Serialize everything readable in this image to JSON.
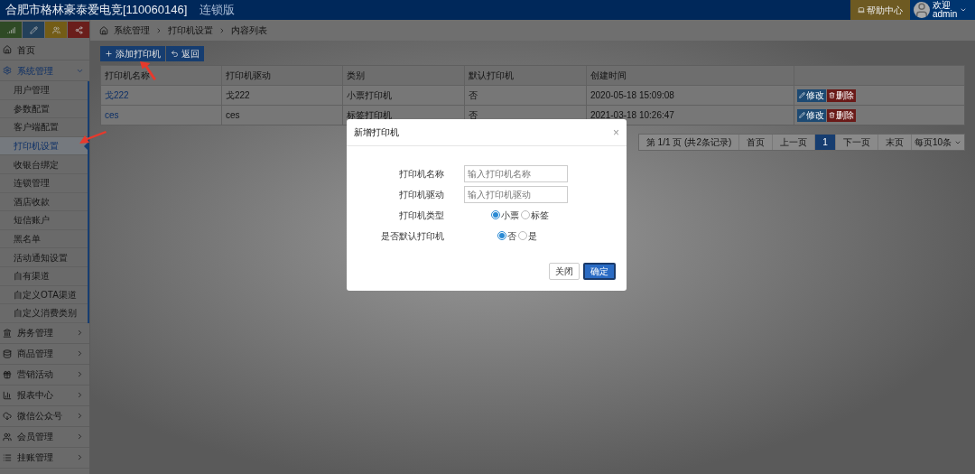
{
  "header": {
    "title": "合肥市格林豪泰爱电竞[110060146]",
    "edition": "连锁版",
    "help": "帮助中心",
    "welcome": "欢迎",
    "user": "admin"
  },
  "sidebar": {
    "shortcuts": [
      {
        "kind": "chart",
        "color": "#2f4a25"
      },
      {
        "kind": "pencil",
        "color": "#23405a"
      },
      {
        "kind": "users",
        "color": "#735c16"
      },
      {
        "kind": "share",
        "color": "#6a1e1b"
      }
    ],
    "items": [
      {
        "label": "首页",
        "expanded": false
      },
      {
        "label": "系统管理",
        "expanded": true,
        "children": [
          {
            "label": "用户管理",
            "selected": false
          },
          {
            "label": "参数配置",
            "selected": false
          },
          {
            "label": "客户端配置",
            "selected": false
          },
          {
            "label": "打印机设置",
            "selected": true
          },
          {
            "label": "收银台绑定",
            "selected": false
          },
          {
            "label": "连锁管理",
            "selected": false
          },
          {
            "label": "酒店收款",
            "selected": false
          },
          {
            "label": "短信账户",
            "selected": false
          },
          {
            "label": "黑名单",
            "selected": false
          },
          {
            "label": "活动通知设置",
            "selected": false
          },
          {
            "label": "自有渠道",
            "selected": false
          },
          {
            "label": "自定义OTA渠道",
            "selected": false
          },
          {
            "label": "自定义消费类别",
            "selected": false
          }
        ]
      },
      {
        "label": "房务管理",
        "expanded": false
      },
      {
        "label": "商品管理",
        "expanded": false
      },
      {
        "label": "营销活动",
        "expanded": false
      },
      {
        "label": "报表中心",
        "expanded": false
      },
      {
        "label": "微信公众号",
        "expanded": false
      },
      {
        "label": "会员管理",
        "expanded": false
      },
      {
        "label": "挂账管理",
        "expanded": false
      }
    ]
  },
  "breadcrumb": [
    "系统管理",
    "打印机设置",
    "内容列表"
  ],
  "toolbar": [
    {
      "label": "添加打印机",
      "kind": "add"
    },
    {
      "label": "返回",
      "kind": "back"
    }
  ],
  "table": {
    "columns": [
      "打印机名称",
      "打印机驱动",
      "类别",
      "默认打印机",
      "创建时间"
    ],
    "rows": [
      {
        "cells": [
          "戈222",
          "戈222",
          "小票打印机",
          "否",
          "2020-05-18 15:09:08"
        ],
        "actions": [
          "修改",
          "删除"
        ]
      },
      {
        "cells": [
          "ces",
          "ces",
          "标签打印机",
          "否",
          "2021-03-18 10:26:47"
        ],
        "actions": [
          "修改",
          "删除"
        ]
      }
    ]
  },
  "pagination": {
    "info": "第 1/1 页 (共2条记录)",
    "pages": [
      {
        "label": "首页",
        "selected": false
      },
      {
        "label": "上一页",
        "selected": false
      },
      {
        "label": "1",
        "selected": true
      },
      {
        "label": "下一页",
        "selected": false
      },
      {
        "label": "末页",
        "selected": false
      }
    ],
    "page_size": "每页10条"
  },
  "dialog": {
    "title": "新增打印机",
    "close": "×",
    "fields": [
      {
        "kind": "text",
        "label": "打印机名称",
        "placeholder": "输入打印机名称"
      },
      {
        "kind": "text",
        "label": "打印机驱动",
        "placeholder": "输入打印机驱动"
      },
      {
        "kind": "radio",
        "label": "打印机类型",
        "options": [
          {
            "label": "小票",
            "selected": true
          },
          {
            "label": "标签",
            "selected": false
          }
        ]
      },
      {
        "kind": "radio",
        "label": "是否默认打印机",
        "options": [
          {
            "label": "否",
            "selected": true
          },
          {
            "label": "是",
            "selected": false
          }
        ]
      }
    ],
    "buttons": [
      {
        "label": "关闭",
        "kind": "default"
      },
      {
        "label": "确定",
        "kind": "primary"
      }
    ]
  }
}
